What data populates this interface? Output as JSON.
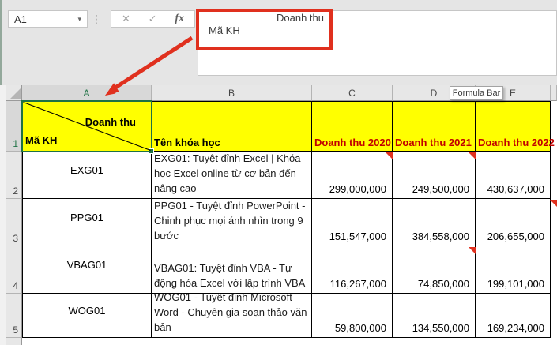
{
  "formula_ui": {
    "name_box": "A1",
    "dropdown_icon": "▾",
    "dots_icon": "⋮",
    "cancel_icon": "✕",
    "enter_icon": "✓",
    "fx_icon": "fx",
    "line1": "Doanh thu",
    "line2": "Mã KH"
  },
  "tooltip": {
    "label": "Formula Bar"
  },
  "colors": {
    "accent_green": "#1e7145",
    "highlight_yellow": "#ffff00",
    "header_text_red": "#c00000",
    "annotation_red": "#e0301e"
  },
  "sheet": {
    "column_headers": [
      "A",
      "B",
      "C",
      "D",
      "E"
    ],
    "row_headers": [
      "1",
      "2",
      "3",
      "4",
      "5"
    ],
    "header": {
      "a_top": "Doanh thu",
      "a_bottom": "Mã KH",
      "b": "Tên khóa học",
      "c": "Doanh thu 2020",
      "d": "Doanh thu 2021",
      "e": "Doanh thu 2022"
    },
    "rows": [
      {
        "code": "EXG01",
        "name": "EXG01: Tuyệt đỉnh Excel | Khóa học Excel online từ cơ bản đến nâng cao",
        "v2020": "299,000,000",
        "v2021": "249,500,000",
        "v2022": "430,637,000"
      },
      {
        "code": "PPG01",
        "name": "PPG01 - Tuyệt đỉnh PowerPoint - Chinh phục mọi ánh nhìn trong 9 bước",
        "v2020": "151,547,000",
        "v2021": "384,558,000",
        "v2022": "206,655,000"
      },
      {
        "code": "VBAG01",
        "name": "VBAG01: Tuyệt đỉnh VBA - Tự động hóa Excel với lập trình VBA",
        "v2020": "116,267,000",
        "v2021": "74,850,000",
        "v2022": "199,101,000"
      },
      {
        "code": "WOG01",
        "name": "WOG01 - Tuyệt đỉnh Microsoft Word - Chuyên gia soạn thảo văn bản",
        "v2020": "59,800,000",
        "v2021": "134,550,000",
        "v2022": "169,234,000"
      }
    ]
  }
}
